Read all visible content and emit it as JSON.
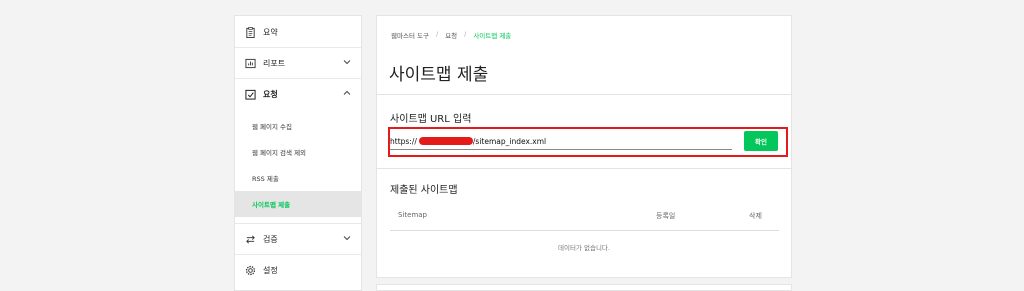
{
  "sidebar": {
    "summary": "요약",
    "report": "리포트",
    "request": "요청",
    "request_sub": [
      "웹 페이지 수집",
      "웹 페이지 검색 제외",
      "RSS 제출",
      "사이트맵 제출"
    ],
    "verify": "검증",
    "settings": "설정"
  },
  "breadcrumb": [
    "웹마스터 도구",
    "요청",
    "사이트맵 제출"
  ],
  "page_title": "사이트맵 제출",
  "sitemap_url": {
    "label": "사이트맵 URL 입력",
    "value_prefix": "https://",
    "value_suffix": "/sitemap_index.xml",
    "confirm": "확인"
  },
  "submitted": {
    "label": "제출된 사이트맵",
    "columns": [
      "Sitemap",
      "등록일",
      "삭제"
    ],
    "empty": "데이터가 없습니다."
  },
  "colors": {
    "accent": "#03c75a",
    "highlight": "#e31b1b"
  }
}
